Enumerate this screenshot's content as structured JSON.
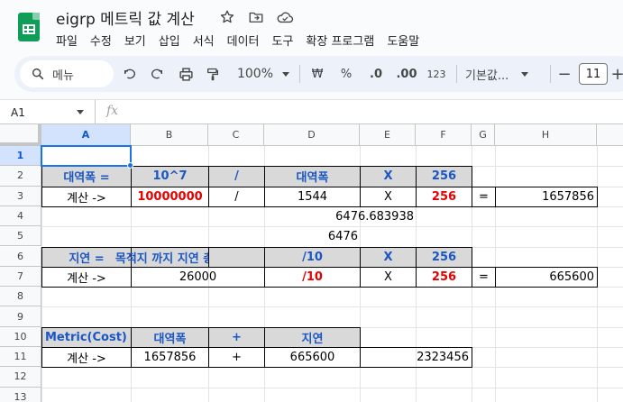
{
  "doc": {
    "title": "eigrp 메트릭 값 계산"
  },
  "icons": {
    "star": "star-icon",
    "move": "move-to-folder-icon",
    "cloud": "cloud-status-icon"
  },
  "menu": [
    "파일",
    "수정",
    "보기",
    "삽입",
    "서식",
    "데이터",
    "도구",
    "확장 프로그램",
    "도움말"
  ],
  "toolbar": {
    "search_label": "메뉴",
    "zoom": "100%",
    "currency": "₩",
    "percent": "%",
    "dec_decrease": ".0",
    "dec_increase": ".00",
    "number_format": "123",
    "font_name": "기본값...",
    "font_minus": "−",
    "font_size": "11",
    "font_plus": "+"
  },
  "formula_bar": {
    "cell_ref": "A1",
    "fx": "fx"
  },
  "columns": [
    "A",
    "B",
    "C",
    "D",
    "E",
    "F",
    "G",
    "H"
  ],
  "rows": [
    "1",
    "2",
    "3",
    "4",
    "5",
    "6",
    "7",
    "8",
    "9",
    "10",
    "11",
    "12",
    "13"
  ],
  "cells": {
    "A2": "대역폭 =",
    "B2": "10^7",
    "C2": "/",
    "D2": "대역폭",
    "E2": "X",
    "F2": "256",
    "A3": "계산 ->",
    "B3": "10000000",
    "C3": "/",
    "D3": "1544",
    "E3": "X",
    "F3": "256",
    "G3": "=",
    "H3": "1657856",
    "D4": "6476.683938",
    "D5": "6476",
    "A6": "지연 =",
    "B6": "목적지 까지 지연 총합",
    "D6": "/10",
    "E6": "X",
    "F6": "256",
    "A7": "계산 ->",
    "B7": "26000",
    "C7": "",
    "D7": "/10",
    "E7": "X",
    "F7": "256",
    "G7": "=",
    "H7": "665600",
    "A10": "Metric(Cost) =",
    "B10": "대역폭",
    "C10": "+",
    "D10": "지연",
    "A11": "계산 ->",
    "B11": "1657856",
    "C11": "+",
    "D11": "665600",
    "E11": "2323456"
  },
  "colors": {
    "accent": "#1a73e8",
    "header_text": "#1a56c4",
    "red_value": "#e60000",
    "header_fill": "#d9d9d9",
    "logo": "#0f9d58"
  }
}
